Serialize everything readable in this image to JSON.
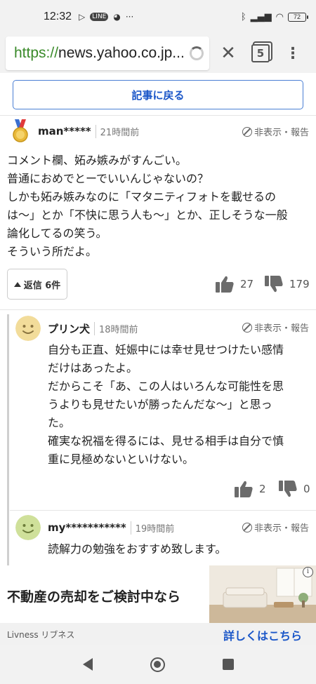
{
  "status_bar": {
    "time": "12:32",
    "left_icons": [
      "play-icon",
      "line-icon",
      "chat-icon",
      "more-icon"
    ],
    "right_icons": [
      "bluetooth-icon",
      "signal-icon",
      "wifi-icon"
    ],
    "battery": "72"
  },
  "browser": {
    "url_scheme": "https://",
    "url_host": "news.yahoo.co.jp...",
    "tab_count": "5"
  },
  "back_to_article": "記事に戻る",
  "comments": [
    {
      "user": "man*****",
      "time": "21時間前",
      "report": "非表示・報告",
      "body": "コメント欄、妬み嫉みがすんごい。\n普通におめでとーでいいんじゃないの？\nしかも妬み嫉みなのに「マタニティフォトを載せるの\nは〜」とか「不快に思う人も〜」とか、正しそうな一般\n論化してるの笑う。\nそういう所だよ。",
      "replies_label": "返信 6件",
      "likes": "27",
      "dislikes": "179"
    }
  ],
  "replies": [
    {
      "user": "プリン犬",
      "time": "18時間前",
      "report": "非表示・報告",
      "body": "自分も正直、妊娠中には幸せ見せつけたい感情\nだけはあったよ。\nだからこそ「あ、この人はいろんな可能性を思\nうよりも見せたいが勝ったんだな〜」と思っ\nた。\n確実な祝福を得るには、見せる相手は自分で慎\n重に見極めないといけない。",
      "likes": "2",
      "dislikes": "0",
      "avatar_color": "#f2dc9a"
    },
    {
      "user": "my***********",
      "time": "19時間前",
      "report": "非表示・報告",
      "body": "読解力の勉強をおすすめ致します。",
      "avatar_color": "#cfe09a"
    }
  ],
  "ad": {
    "title": "不動産の売却をご検討中なら",
    "brand": "Livness リブネス",
    "cta": "詳しくはこちら",
    "info_glyph": "i"
  }
}
